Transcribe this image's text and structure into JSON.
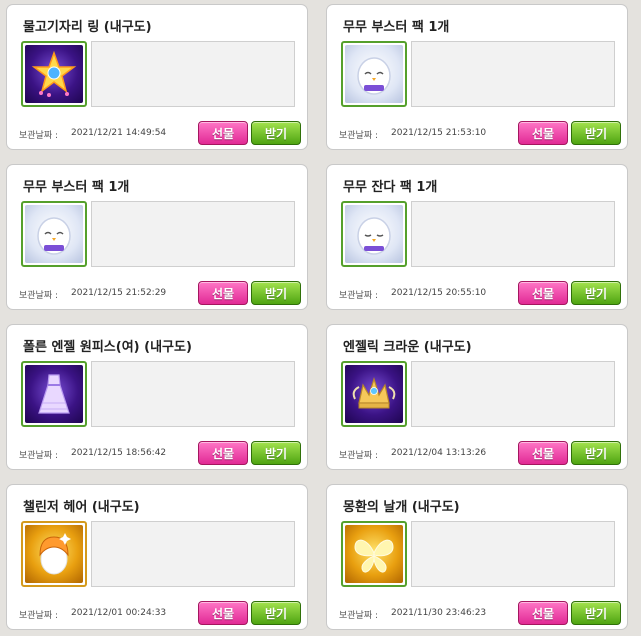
{
  "labels": {
    "storage_date": "보관날짜 :",
    "gift_button": "선물",
    "receive_button": "받기"
  },
  "items": [
    {
      "title": "물고기자리 링 (내구도)",
      "date": "2021/12/21 14:49:54",
      "icon": "star-ring-icon"
    },
    {
      "title": "무무 부스터 팩 1개",
      "date": "2021/12/15 21:53:10",
      "icon": "mumu-egg-icon"
    },
    {
      "title": "무무 부스터 팩 1개",
      "date": "2021/12/15 21:52:29",
      "icon": "mumu-egg-icon"
    },
    {
      "title": "무무 잔다 팩 1개",
      "date": "2021/12/15 20:55:10",
      "icon": "mumu-egg-icon"
    },
    {
      "title": "폴른 엔젤 원피스(여) (내구도)",
      "date": "2021/12/15 18:56:42",
      "icon": "dress-icon"
    },
    {
      "title": "엔젤릭 크라운 (내구도)",
      "date": "2021/12/04 13:13:26",
      "icon": "crown-icon"
    },
    {
      "title": "챌린저 헤어 (내구도)",
      "date": "2021/12/01 00:24:33",
      "icon": "hair-icon"
    },
    {
      "title": "몽환의 날개 (내구도)",
      "date": "2021/11/30 23:46:23",
      "icon": "wings-icon"
    }
  ]
}
